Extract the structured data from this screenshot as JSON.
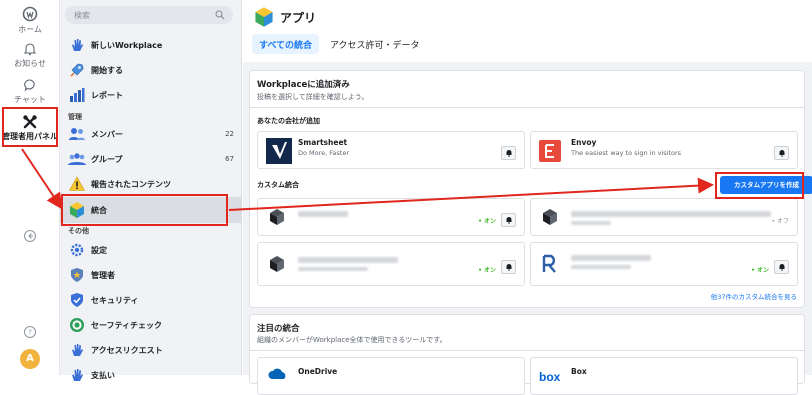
{
  "rail": {
    "home": "ホーム",
    "notifications": "お知らせ",
    "chat": "チャット",
    "admin_panel": "管理者用パネル",
    "avatar_letter": "A"
  },
  "sidebar": {
    "search_placeholder": "検索",
    "top_items": [
      {
        "label": "新しいWorkplace"
      },
      {
        "label": "開始する"
      },
      {
        "label": "レポート"
      }
    ],
    "section_manage": "管理",
    "manage_items": [
      {
        "label": "メンバー",
        "count": "22"
      },
      {
        "label": "グループ",
        "count": "67"
      },
      {
        "label": "報告されたコンテンツ"
      },
      {
        "label": "統合"
      }
    ],
    "section_other": "その他",
    "other_items": [
      {
        "label": "設定"
      },
      {
        "label": "管理者"
      },
      {
        "label": "セキュリティ"
      },
      {
        "label": "セーフティチェック"
      },
      {
        "label": "アクセスリクエスト"
      },
      {
        "label": "支払い"
      }
    ]
  },
  "main": {
    "title": "アプリ",
    "tabs": [
      {
        "label": "すべての統合",
        "active": true
      },
      {
        "label": "アクセス許可・データ",
        "active": false
      }
    ],
    "added": {
      "title": "Workplaceに追加済み",
      "subtitle": "投稿を選択して詳細を確認しよう。",
      "company_title": "あなたの会社が追加",
      "apps": [
        {
          "name": "Smartsheet",
          "desc": "Do More, Faster"
        },
        {
          "name": "Envoy",
          "desc": "The easiest way to sign in visitors"
        }
      ],
      "custom_title": "カスタム統合",
      "create_button": "カスタムアプリを作成",
      "custom_apps": [
        {
          "status": "• オン"
        },
        {
          "status": "• オフ"
        },
        {
          "status": "• オン"
        },
        {
          "status": "• オン"
        }
      ],
      "see_all_link": "他37件のカスタム統合を見る"
    },
    "featured": {
      "title": "注目の統合",
      "subtitle": "組織のメンバーがWorkplace全体で使用できるツールです。",
      "apps": [
        {
          "name": "OneDrive"
        },
        {
          "name": "Box"
        }
      ]
    }
  },
  "colors": {
    "accent": "#1877f2",
    "highlight_red": "#e0261d",
    "status_on": "#42b72a"
  }
}
